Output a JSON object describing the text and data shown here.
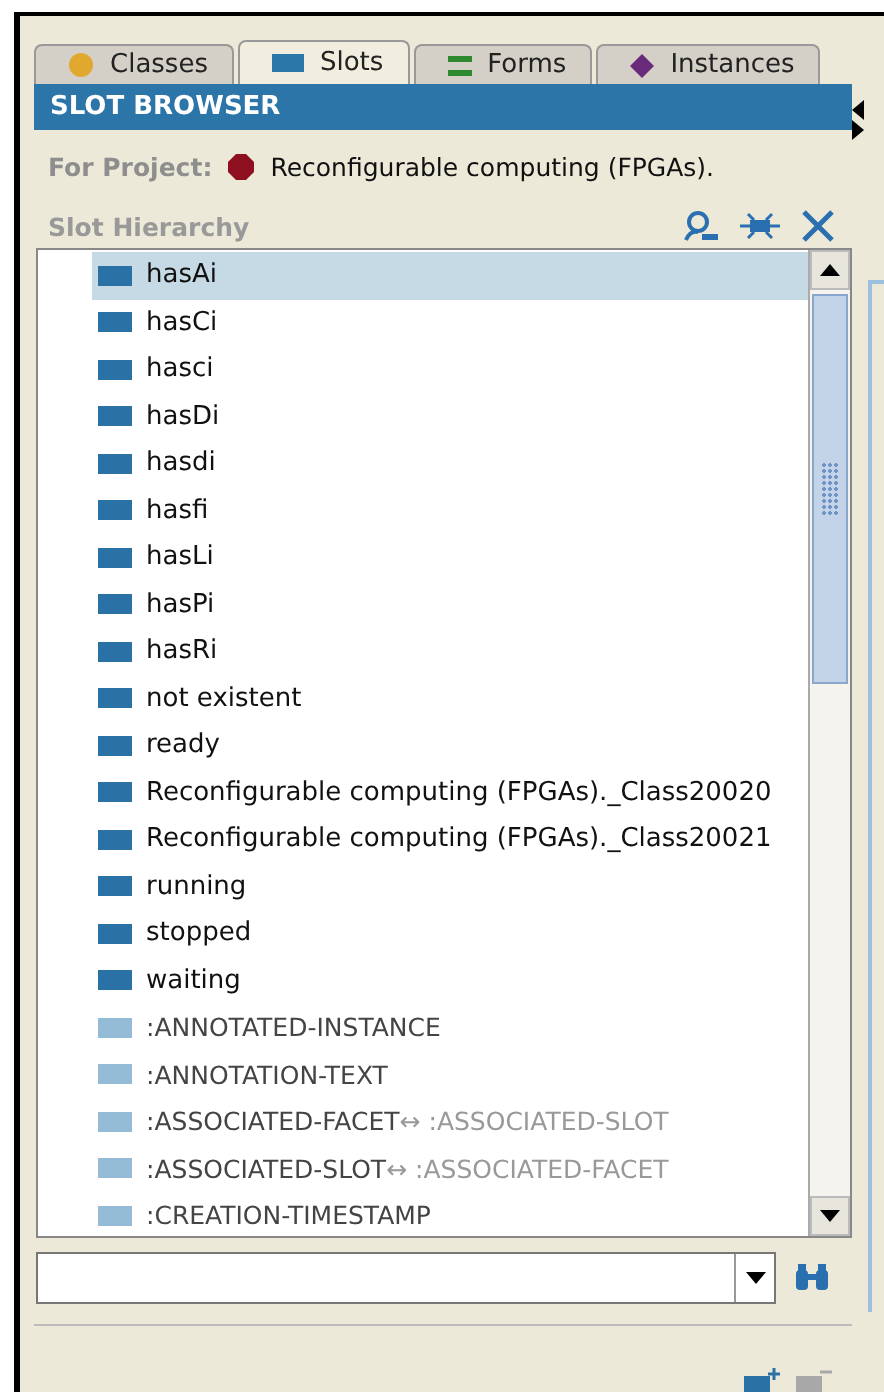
{
  "tabs": [
    {
      "label": "Classes",
      "kind": "classes",
      "selected": false
    },
    {
      "label": "Slots",
      "kind": "slots",
      "selected": true
    },
    {
      "label": "Forms",
      "kind": "forms",
      "selected": false
    },
    {
      "label": "Instances",
      "kind": "instances",
      "selected": false
    }
  ],
  "panel": {
    "title": "SLOT BROWSER",
    "project_label": "For Project:",
    "project_name": "Reconfigurable computing (FPGAs).",
    "hierarchy_label": "Slot Hierarchy"
  },
  "slots": [
    {
      "name": "hasAi",
      "kind": "user",
      "selected": true
    },
    {
      "name": "hasCi",
      "kind": "user",
      "selected": false
    },
    {
      "name": "hasci",
      "kind": "user",
      "selected": false
    },
    {
      "name": "hasDi",
      "kind": "user",
      "selected": false
    },
    {
      "name": "hasdi",
      "kind": "user",
      "selected": false
    },
    {
      "name": "hasfi",
      "kind": "user",
      "selected": false
    },
    {
      "name": "hasLi",
      "kind": "user",
      "selected": false
    },
    {
      "name": "hasPi",
      "kind": "user",
      "selected": false
    },
    {
      "name": "hasRi",
      "kind": "user",
      "selected": false
    },
    {
      "name": "not existent",
      "kind": "user",
      "selected": false
    },
    {
      "name": "ready",
      "kind": "user",
      "selected": false
    },
    {
      "name": "Reconfigurable computing (FPGAs)._Class20020",
      "kind": "user",
      "selected": false
    },
    {
      "name": "Reconfigurable computing (FPGAs)._Class20021",
      "kind": "user",
      "selected": false
    },
    {
      "name": "running",
      "kind": "user",
      "selected": false
    },
    {
      "name": "stopped",
      "kind": "user",
      "selected": false
    },
    {
      "name": "waiting",
      "kind": "user",
      "selected": false
    },
    {
      "name": ":ANNOTATED-INSTANCE",
      "kind": "system",
      "selected": false
    },
    {
      "name": ":ANNOTATION-TEXT",
      "kind": "system",
      "selected": false
    },
    {
      "name": ":ASSOCIATED-FACET",
      "kind": "system",
      "selected": false,
      "inverse": "↔ :ASSOCIATED-SLOT"
    },
    {
      "name": ":ASSOCIATED-SLOT",
      "kind": "system",
      "selected": false,
      "inverse": "↔ :ASSOCIATED-FACET"
    },
    {
      "name": ":CREATION-TIMESTAMP",
      "kind": "system",
      "selected": false
    }
  ]
}
